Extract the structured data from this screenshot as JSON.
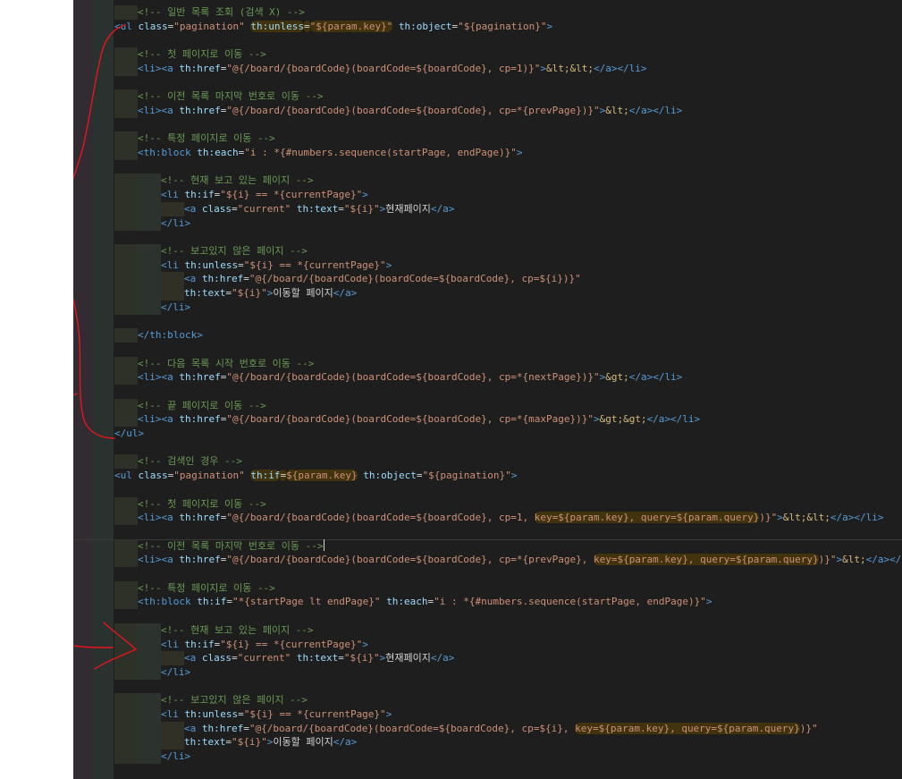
{
  "colors": {
    "background": "#1e1e1e",
    "comment": "#6a9955",
    "tag": "#569cd6",
    "attribute": "#9cdcfe",
    "string": "#ce9178",
    "entity": "#d7ba7d",
    "annotation": "#e8141c"
  },
  "code_lines": [
    {
      "i": 1,
      "hl": false,
      "tokens": [
        [
          "c",
          "<!-- 일반 목록 조회 (검색 X) -->"
        ]
      ]
    },
    {
      "i": 0,
      "hl": false,
      "tokens": [
        [
          "t",
          "<ul "
        ],
        [
          "a",
          "class"
        ],
        [
          "d",
          "="
        ],
        [
          "s",
          "\"pagination\""
        ],
        [
          "d",
          " "
        ],
        [
          "a",
          "th:unless",
          "m"
        ],
        [
          "d",
          "=",
          "m"
        ],
        [
          "s",
          "\"${param.key}\"",
          "m"
        ],
        [
          "d",
          " "
        ],
        [
          "a",
          "th:object"
        ],
        [
          "d",
          "="
        ],
        [
          "s",
          "\"${pagination}\""
        ],
        [
          "t",
          ">"
        ]
      ]
    },
    {
      "i": 0,
      "hl": false,
      "tokens": []
    },
    {
      "i": 1,
      "hl": false,
      "tokens": [
        [
          "c",
          "<!-- 첫 페이지로 이동 -->"
        ]
      ]
    },
    {
      "i": 1,
      "hl": false,
      "tokens": [
        [
          "t",
          "<li><a "
        ],
        [
          "a",
          "th:href"
        ],
        [
          "d",
          "="
        ],
        [
          "s",
          "\"@{/board/{boardCode}(boardCode=${boardCode}, cp=1)}\""
        ],
        [
          "t",
          ">"
        ],
        [
          "e",
          "&lt;&lt;"
        ],
        [
          "t",
          "</a></li>"
        ]
      ]
    },
    {
      "i": 0,
      "hl": false,
      "tokens": []
    },
    {
      "i": 1,
      "hl": false,
      "tokens": [
        [
          "c",
          "<!-- 이전 목록 마지막 번호로 이동 -->"
        ]
      ]
    },
    {
      "i": 1,
      "hl": false,
      "tokens": [
        [
          "t",
          "<li><a "
        ],
        [
          "a",
          "th:href"
        ],
        [
          "d",
          "="
        ],
        [
          "s",
          "\"@{/board/{boardCode}(boardCode=${boardCode}, cp=*{prevPage})}\""
        ],
        [
          "t",
          ">"
        ],
        [
          "e",
          "&lt;"
        ],
        [
          "t",
          "</a></li>"
        ]
      ]
    },
    {
      "i": 0,
      "hl": false,
      "tokens": []
    },
    {
      "i": 1,
      "hl": false,
      "tokens": [
        [
          "c",
          "<!-- 특정 페이지로 이동 -->"
        ]
      ]
    },
    {
      "i": 1,
      "hl": false,
      "tokens": [
        [
          "t",
          "<th:block "
        ],
        [
          "a",
          "th:each"
        ],
        [
          "d",
          "="
        ],
        [
          "s",
          "\"i : *{#numbers.sequence(startPage, endPage)}\""
        ],
        [
          "t",
          ">"
        ]
      ]
    },
    {
      "i": 0,
      "hl": false,
      "tokens": []
    },
    {
      "i": 2,
      "hl": false,
      "tokens": [
        [
          "c",
          "<!-- 현재 보고 있는 페이지 -->"
        ]
      ]
    },
    {
      "i": 2,
      "hl": false,
      "tokens": [
        [
          "t",
          "<li "
        ],
        [
          "a",
          "th:if"
        ],
        [
          "d",
          "="
        ],
        [
          "s",
          "\"${i} == *{currentPage}\""
        ],
        [
          "t",
          ">"
        ]
      ]
    },
    {
      "i": 3,
      "hl": false,
      "tokens": [
        [
          "t",
          "<a "
        ],
        [
          "a",
          "class"
        ],
        [
          "d",
          "="
        ],
        [
          "s",
          "\"current\""
        ],
        [
          "d",
          " "
        ],
        [
          "a",
          "th:text"
        ],
        [
          "d",
          "="
        ],
        [
          "s",
          "\"${i}\""
        ],
        [
          "t",
          ">"
        ],
        [
          "d",
          "현재페이지"
        ],
        [
          "t",
          "</a>"
        ]
      ]
    },
    {
      "i": 2,
      "hl": false,
      "tokens": [
        [
          "t",
          "</li>"
        ]
      ]
    },
    {
      "i": 0,
      "hl": false,
      "tokens": []
    },
    {
      "i": 2,
      "hl": false,
      "tokens": [
        [
          "c",
          "<!-- 보고있지 않은 페이지 -->"
        ]
      ]
    },
    {
      "i": 2,
      "hl": false,
      "tokens": [
        [
          "t",
          "<li "
        ],
        [
          "a",
          "th:unless"
        ],
        [
          "d",
          "="
        ],
        [
          "s",
          "\"${i} == *{currentPage}\""
        ],
        [
          "t",
          ">"
        ]
      ]
    },
    {
      "i": 3,
      "hl": false,
      "tokens": [
        [
          "t",
          "<a "
        ],
        [
          "a",
          "th:href"
        ],
        [
          "d",
          "="
        ],
        [
          "s",
          "\"@{/board/{boardCode}(boardCode=${boardCode}, cp=${i})}\""
        ]
      ]
    },
    {
      "i": 3,
      "hl": false,
      "tokens": [
        [
          "a",
          "th:text"
        ],
        [
          "d",
          "="
        ],
        [
          "s",
          "\"${i}\""
        ],
        [
          "t",
          ">"
        ],
        [
          "d",
          "이동할 페이지"
        ],
        [
          "t",
          "</a>"
        ]
      ]
    },
    {
      "i": 2,
      "hl": false,
      "tokens": [
        [
          "t",
          "</li>"
        ]
      ]
    },
    {
      "i": 0,
      "hl": false,
      "tokens": []
    },
    {
      "i": 1,
      "hl": false,
      "tokens": [
        [
          "t",
          "</th:block>"
        ]
      ]
    },
    {
      "i": 0,
      "hl": false,
      "tokens": []
    },
    {
      "i": 1,
      "hl": false,
      "tokens": [
        [
          "c",
          "<!-- 다음 목록 시작 번호로 이동 -->"
        ]
      ]
    },
    {
      "i": 1,
      "hl": false,
      "tokens": [
        [
          "t",
          "<li><a "
        ],
        [
          "a",
          "th:href"
        ],
        [
          "d",
          "="
        ],
        [
          "s",
          "\"@{/board/{boardCode}(boardCode=${boardCode}, cp=*{nextPage})}\""
        ],
        [
          "t",
          ">"
        ],
        [
          "e",
          "&gt;"
        ],
        [
          "t",
          "</a></li>"
        ]
      ]
    },
    {
      "i": 0,
      "hl": false,
      "tokens": []
    },
    {
      "i": 1,
      "hl": false,
      "tokens": [
        [
          "c",
          "<!-- 끝 페이지로 이동 -->"
        ]
      ]
    },
    {
      "i": 1,
      "hl": false,
      "tokens": [
        [
          "t",
          "<li><a "
        ],
        [
          "a",
          "th:href"
        ],
        [
          "d",
          "="
        ],
        [
          "s",
          "\"@{/board/{boardCode}(boardCode=${boardCode}, cp=*{maxPage})}\""
        ],
        [
          "t",
          ">"
        ],
        [
          "e",
          "&gt;&gt;"
        ],
        [
          "t",
          "</a></li>"
        ]
      ]
    },
    {
      "i": 0,
      "hl": false,
      "tokens": [
        [
          "t",
          "</ul>"
        ]
      ]
    },
    {
      "i": 0,
      "hl": false,
      "tokens": []
    },
    {
      "i": 1,
      "hl": false,
      "tokens": [
        [
          "c",
          "<!-- 검색인 경우 -->"
        ]
      ]
    },
    {
      "i": 0,
      "hl": false,
      "tokens": [
        [
          "t",
          "<ul "
        ],
        [
          "a",
          "class"
        ],
        [
          "d",
          "="
        ],
        [
          "s",
          "\"pagination\""
        ],
        [
          "d",
          " "
        ],
        [
          "a",
          "th:if",
          "m"
        ],
        [
          "d",
          "=",
          "m"
        ],
        [
          "s",
          "${param.key}",
          "m"
        ],
        [
          "d",
          " "
        ],
        [
          "a",
          "th:object"
        ],
        [
          "d",
          "="
        ],
        [
          "s",
          "\"${pagination}\""
        ],
        [
          "t",
          ">"
        ]
      ]
    },
    {
      "i": 0,
      "hl": false,
      "tokens": []
    },
    {
      "i": 1,
      "hl": false,
      "tokens": [
        [
          "c",
          "<!-- 첫 페이지로 이동 -->"
        ]
      ]
    },
    {
      "i": 1,
      "hl": false,
      "tokens": [
        [
          "t",
          "<li><a "
        ],
        [
          "a",
          "th:href"
        ],
        [
          "d",
          "="
        ],
        [
          "s",
          "\"@{/board/{boardCode}(boardCode=${boardCode}, cp=1, "
        ],
        [
          "s",
          "key=${param.key}, query=${param.query}",
          "m"
        ],
        [
          "s",
          ")}\""
        ],
        [
          "t",
          ">"
        ],
        [
          "e",
          "&lt;&lt;"
        ],
        [
          "t",
          "</a></li>"
        ]
      ]
    },
    {
      "i": 0,
      "hl": false,
      "tokens": []
    },
    {
      "i": 1,
      "hl": true,
      "tokens": [
        [
          "c",
          "<!-- 이전 목록 마지막 번호로 이동 -->"
        ],
        [
          "caret",
          ""
        ]
      ]
    },
    {
      "i": 1,
      "hl": false,
      "tokens": [
        [
          "t",
          "<li><a "
        ],
        [
          "a",
          "th:href"
        ],
        [
          "d",
          "="
        ],
        [
          "s",
          "\"@{/board/{boardCode}(boardCode=${boardCode}, cp=*{prevPage}, "
        ],
        [
          "s",
          "key=${param.key}, query=${param.query}",
          "m"
        ],
        [
          "s",
          ")}\""
        ],
        [
          "t",
          ">"
        ],
        [
          "e",
          "&lt;"
        ],
        [
          "t",
          "</a></li>"
        ]
      ]
    },
    {
      "i": 0,
      "hl": false,
      "tokens": []
    },
    {
      "i": 1,
      "hl": false,
      "tokens": [
        [
          "c",
          "<!-- 특정 페이지로 이동 -->"
        ]
      ]
    },
    {
      "i": 1,
      "hl": false,
      "tokens": [
        [
          "t",
          "<th:block "
        ],
        [
          "a",
          "th:if"
        ],
        [
          "d",
          "="
        ],
        [
          "s",
          "\"*{startPage lt endPage}\""
        ],
        [
          "d",
          " "
        ],
        [
          "a",
          "th:each"
        ],
        [
          "d",
          "="
        ],
        [
          "s",
          "\"i : *{#numbers.sequence(startPage, endPage)}\""
        ],
        [
          "t",
          ">"
        ]
      ]
    },
    {
      "i": 0,
      "hl": false,
      "tokens": []
    },
    {
      "i": 2,
      "hl": false,
      "tokens": [
        [
          "c",
          "<!-- 현재 보고 있는 페이지 -->"
        ]
      ]
    },
    {
      "i": 2,
      "hl": false,
      "tokens": [
        [
          "t",
          "<li "
        ],
        [
          "a",
          "th:if"
        ],
        [
          "d",
          "="
        ],
        [
          "s",
          "\"${i} == *{currentPage}\""
        ],
        [
          "t",
          ">"
        ]
      ]
    },
    {
      "i": 3,
      "hl": false,
      "tokens": [
        [
          "t",
          "<a "
        ],
        [
          "a",
          "class"
        ],
        [
          "d",
          "="
        ],
        [
          "s",
          "\"current\""
        ],
        [
          "d",
          " "
        ],
        [
          "a",
          "th:text"
        ],
        [
          "d",
          "="
        ],
        [
          "s",
          "\"${i}\""
        ],
        [
          "t",
          ">"
        ],
        [
          "d",
          "현재페이지"
        ],
        [
          "t",
          "</a>"
        ]
      ]
    },
    {
      "i": 2,
      "hl": false,
      "tokens": [
        [
          "t",
          "</li>"
        ]
      ]
    },
    {
      "i": 0,
      "hl": false,
      "tokens": []
    },
    {
      "i": 2,
      "hl": false,
      "tokens": [
        [
          "c",
          "<!-- 보고있지 않은 페이지 -->"
        ]
      ]
    },
    {
      "i": 2,
      "hl": false,
      "tokens": [
        [
          "t",
          "<li "
        ],
        [
          "a",
          "th:unless"
        ],
        [
          "d",
          "="
        ],
        [
          "s",
          "\"${i} == *{currentPage}\""
        ],
        [
          "t",
          ">"
        ]
      ]
    },
    {
      "i": 3,
      "hl": false,
      "tokens": [
        [
          "t",
          "<a "
        ],
        [
          "a",
          "th:href"
        ],
        [
          "d",
          "="
        ],
        [
          "s",
          "\"@{/board/{boardCode}(boardCode=${boardCode}, cp=${i}, "
        ],
        [
          "s",
          "key=${param.key}, query=${param.query}",
          "m"
        ],
        [
          "s",
          ")}\""
        ]
      ]
    },
    {
      "i": 3,
      "hl": false,
      "tokens": [
        [
          "a",
          "th:text"
        ],
        [
          "d",
          "="
        ],
        [
          "s",
          "\"${i}\""
        ],
        [
          "t",
          ">"
        ],
        [
          "d",
          "이동할 페이지"
        ],
        [
          "t",
          "</a>"
        ]
      ]
    },
    {
      "i": 2,
      "hl": false,
      "tokens": [
        [
          "t",
          "</li>"
        ]
      ]
    }
  ]
}
